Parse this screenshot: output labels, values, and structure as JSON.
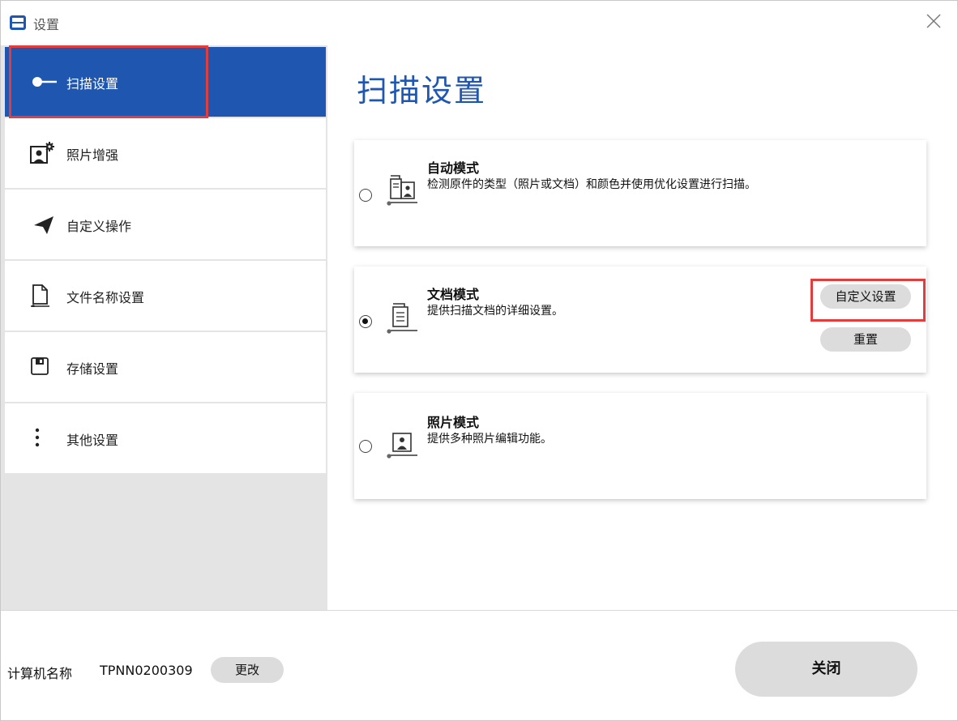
{
  "window": {
    "title": "设置"
  },
  "sidebar": {
    "items": [
      {
        "label": "扫描设置",
        "icon": "scan-settings-icon",
        "active": true
      },
      {
        "label": "照片增强",
        "icon": "photo-enhance-icon",
        "active": false
      },
      {
        "label": "自定义操作",
        "icon": "send-icon",
        "active": false
      },
      {
        "label": "文件名称设置",
        "icon": "file-icon",
        "active": false
      },
      {
        "label": "存储设置",
        "icon": "save-icon",
        "active": false
      },
      {
        "label": "其他设置",
        "icon": "more-icon",
        "active": false
      }
    ]
  },
  "main": {
    "title": "扫描设置",
    "modes": [
      {
        "title": "自动模式",
        "description": "检测原件的类型（照片或文档）和颜色并使用优化设置进行扫描。",
        "selected": false
      },
      {
        "title": "文档模式",
        "description": "提供扫描文档的详细设置。",
        "selected": true,
        "custom_button": "自定义设置",
        "reset_button": "重置"
      },
      {
        "title": "照片模式",
        "description": "提供多种照片编辑功能。",
        "selected": false
      }
    ]
  },
  "footer": {
    "computer_name_label": "计算机名称",
    "computer_name": "TPNN0200309",
    "change_button": "更改",
    "close_button": "关闭"
  },
  "colors": {
    "accent": "#1f56b0",
    "highlight": "#e23c3c",
    "button_bg": "#dcdcdc",
    "sidebar_bg": "#e4e4e4"
  }
}
